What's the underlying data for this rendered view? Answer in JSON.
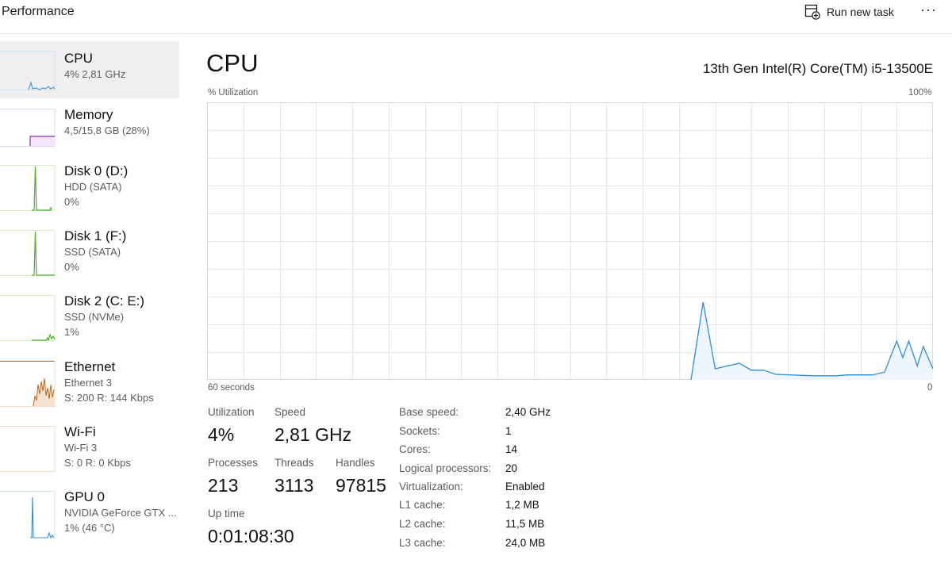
{
  "header": {
    "title": "Performance",
    "run_new_task": "Run new task",
    "more_glyph": "···"
  },
  "sidebar": {
    "items": [
      {
        "name": "CPU",
        "line1": "4%  2,81 GHz",
        "line2": ""
      },
      {
        "name": "Memory",
        "line1": "4,5/15,8 GB (28%)",
        "line2": ""
      },
      {
        "name": "Disk 0 (D:)",
        "line1": "HDD (SATA)",
        "line2": "0%"
      },
      {
        "name": "Disk 1 (F:)",
        "line1": "SSD (SATA)",
        "line2": "0%"
      },
      {
        "name": "Disk 2 (C: E:)",
        "line1": "SSD (NVMe)",
        "line2": "1%"
      },
      {
        "name": "Ethernet",
        "line1": "Ethernet 3",
        "line2": "S: 200  R: 144 Kbps"
      },
      {
        "name": "Wi-Fi",
        "line1": "Wi-Fi 3",
        "line2": "S: 0  R: 0 Kbps"
      },
      {
        "name": "GPU 0",
        "line1": "NVIDIA GeForce GTX ...",
        "line2": "1%  (46 °C)"
      }
    ],
    "thumb_colors": {
      "cpu": "#2f8fd8",
      "memory": "#8b2db0",
      "disk": "#4caf2a",
      "ethernet": "#b5651d",
      "gpu": "#2f8fd8"
    }
  },
  "main": {
    "title": "CPU",
    "model": "13th Gen Intel(R) Core(TM) i5-13500E",
    "graph": {
      "ylabel": "% Utilization",
      "ymax_label": "100%",
      "xlabel_left": "60 seconds",
      "xlabel_right": "0",
      "line_color": "#2f8fd8",
      "fill_color": "#eef5fc",
      "grid_color": "#e6e6e6",
      "history": [
        {
          "t": 60,
          "v": null
        },
        {
          "t": 20,
          "v": 0
        },
        {
          "t": 19,
          "v": 28
        },
        {
          "t": 18,
          "v": 4
        },
        {
          "t": 16,
          "v": 6
        },
        {
          "t": 15,
          "v": 3.5
        },
        {
          "t": 14,
          "v": 3.5
        },
        {
          "t": 13,
          "v": 2
        },
        {
          "t": 10,
          "v": 1.5
        },
        {
          "t": 8,
          "v": 1.5
        },
        {
          "t": 7,
          "v": 1.8
        },
        {
          "t": 5,
          "v": 1.8
        },
        {
          "t": 4,
          "v": 2.8
        },
        {
          "t": 3,
          "v": 14
        },
        {
          "t": 2.5,
          "v": 8
        },
        {
          "t": 2,
          "v": 14
        },
        {
          "t": 1.3,
          "v": 5
        },
        {
          "t": 0.8,
          "v": 12
        },
        {
          "t": 0,
          "v": 4
        }
      ]
    }
  },
  "stats": {
    "utilization": {
      "label": "Utilization",
      "value": "4%"
    },
    "speed": {
      "label": "Speed",
      "value": "2,81 GHz"
    },
    "processes": {
      "label": "Processes",
      "value": "213"
    },
    "threads": {
      "label": "Threads",
      "value": "3113"
    },
    "handles": {
      "label": "Handles",
      "value": "97815"
    },
    "uptime": {
      "label": "Up time",
      "value": "0:01:08:30"
    }
  },
  "specs": [
    {
      "label": "Base speed:",
      "value": "2,40 GHz"
    },
    {
      "label": "Sockets:",
      "value": "1"
    },
    {
      "label": "Cores:",
      "value": "14"
    },
    {
      "label": "Logical processors:",
      "value": "20"
    },
    {
      "label": "Virtualization:",
      "value": "Enabled"
    },
    {
      "label": "L1 cache:",
      "value": "1,2 MB"
    },
    {
      "label": "L2 cache:",
      "value": "11,5 MB"
    },
    {
      "label": "L3 cache:",
      "value": "24,0 MB"
    }
  ]
}
